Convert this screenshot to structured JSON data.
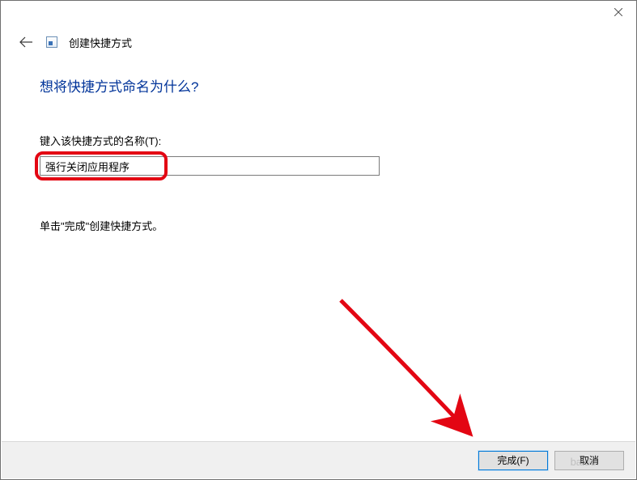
{
  "titlebar": {
    "close_label": "Close"
  },
  "wizard": {
    "back_label": "Back",
    "title": "创建快捷方式",
    "heading": "想将快捷方式命名为什么?",
    "name_label": "键入该快捷方式的名称(T):",
    "name_value": "强行关闭应用程序",
    "instruction": "单击\"完成\"创建快捷方式。"
  },
  "footer": {
    "finish": "完成(F)",
    "cancel": "取消"
  },
  "watermark": "baidu."
}
